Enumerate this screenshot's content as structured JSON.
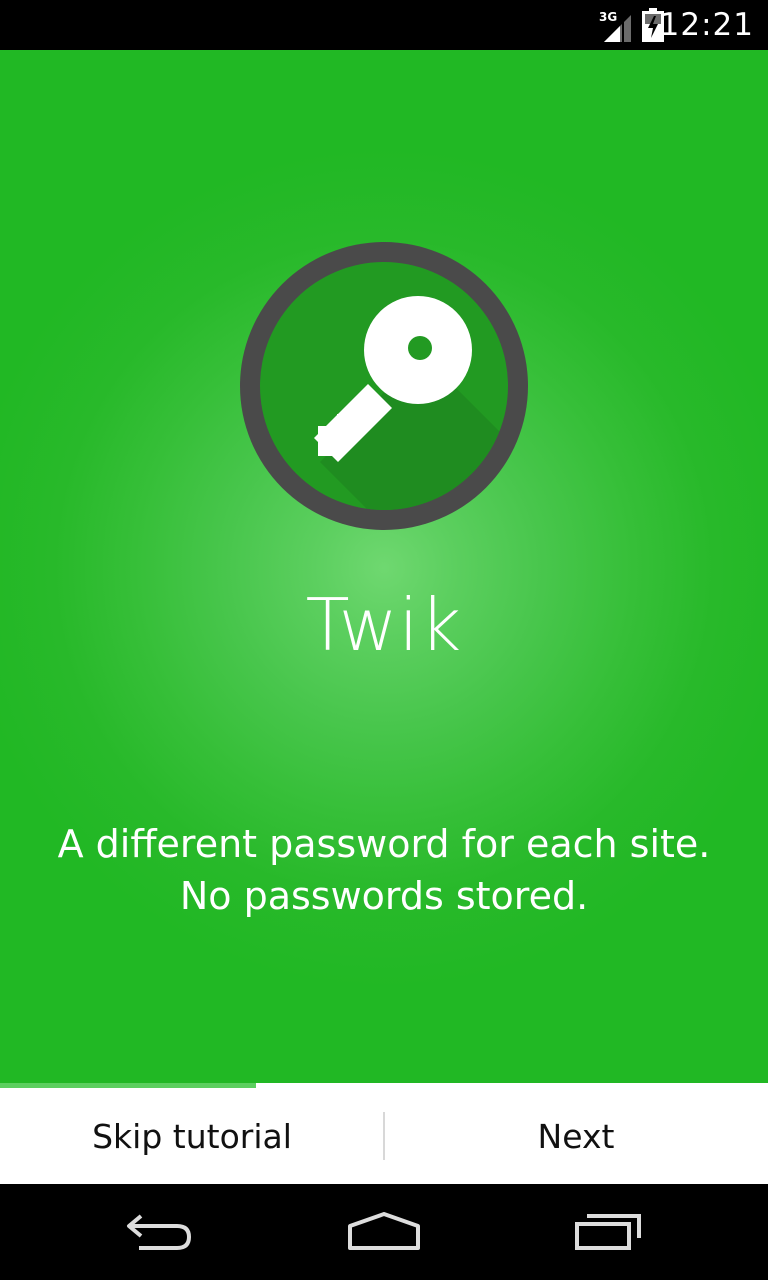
{
  "status_bar": {
    "network": "3G",
    "time": "12:21",
    "icons": [
      "signal-3g-icon",
      "battery-charging-icon"
    ]
  },
  "app": {
    "title": "Twik",
    "tagline_line1": "A different password for each site.",
    "tagline_line2": "No passwords stored.",
    "logo_icon": "key-icon"
  },
  "colors": {
    "background": "#21b824",
    "glow": "#6fd870",
    "logo_ring": "#4a4a4a",
    "logo_inner": "#229a22",
    "progress": "#5ccf5f",
    "action_bar": "#ffffff"
  },
  "tutorial": {
    "progress": 0.333
  },
  "actions": {
    "skip_label": "Skip tutorial",
    "next_label": "Next"
  },
  "nav_bar": {
    "icons": [
      "back-icon",
      "home-icon",
      "recents-icon"
    ]
  }
}
